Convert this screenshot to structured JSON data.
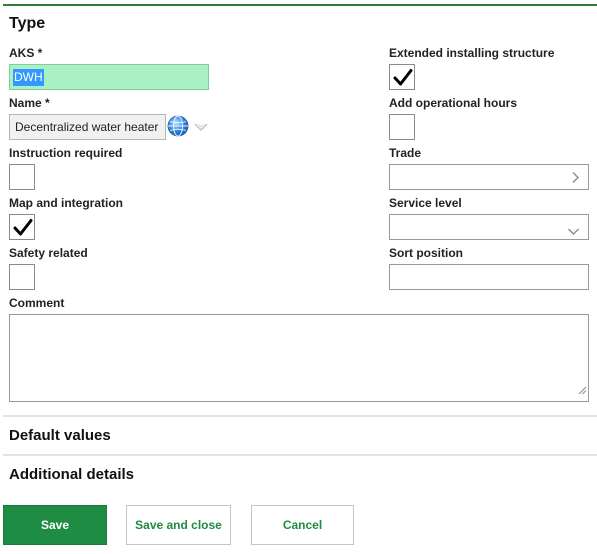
{
  "type_section": {
    "title": "Type",
    "aks": {
      "label": "AKS *",
      "value": "DWH"
    },
    "name": {
      "label": "Name *",
      "value": "Decentralized water heater"
    },
    "instruction_required": {
      "label": "Instruction required",
      "checked": false
    },
    "map_and_integration": {
      "label": "Map and integration",
      "checked": true
    },
    "safety_related": {
      "label": "Safety related",
      "checked": false
    },
    "comment": {
      "label": "Comment",
      "value": ""
    },
    "extended_installing_structure": {
      "label": "Extended installing structure",
      "checked": true
    },
    "add_operational_hours": {
      "label": "Add operational hours",
      "checked": false
    },
    "trade": {
      "label": "Trade",
      "value": ""
    },
    "service_level": {
      "label": "Service level",
      "value": ""
    },
    "sort_position": {
      "label": "Sort position",
      "value": ""
    }
  },
  "default_values": {
    "title": "Default values"
  },
  "additional_details": {
    "title": "Additional details"
  },
  "buttons": {
    "save": "Save",
    "save_and_close": "Save and close",
    "cancel": "Cancel"
  },
  "colors": {
    "accent": "#1f8c43",
    "aks_highlight": "#a9f0c5",
    "selection": "#3399ff"
  },
  "icons": {
    "globe": "globe-icon",
    "dropdown_grey": "chevron-down-icon",
    "trade": "chevron-right-icon",
    "service_level": "chevron-down-icon",
    "check": "checkmark-icon"
  }
}
